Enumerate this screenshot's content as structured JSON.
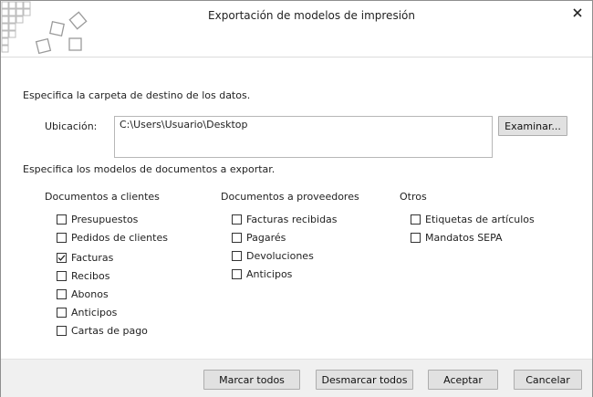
{
  "window": {
    "title": "Exportación de modelos de impresión"
  },
  "destination": {
    "instruction": "Especifica la carpeta de destino de los datos.",
    "location_label": "Ubicación:",
    "location_value": "C:\\Users\\Usuario\\Desktop",
    "browse_label": "Examinar..."
  },
  "models": {
    "instruction": "Especifica los modelos de documentos a exportar.",
    "groups": [
      {
        "title": "Documentos a clientes",
        "items": [
          {
            "label": "Presupuestos",
            "checked": false
          },
          {
            "label": "Pedidos de clientes",
            "checked": false
          },
          {
            "label": "Facturas",
            "checked": true
          },
          {
            "label": "Recibos",
            "checked": false
          },
          {
            "label": "Abonos",
            "checked": false
          },
          {
            "label": "Anticipos",
            "checked": false
          },
          {
            "label": "Cartas de pago",
            "checked": false
          }
        ]
      },
      {
        "title": "Documentos a proveedores",
        "items": [
          {
            "label": "Facturas recibidas",
            "checked": false
          },
          {
            "label": "Pagarés",
            "checked": false
          },
          {
            "label": "Devoluciones",
            "checked": false
          },
          {
            "label": "Anticipos",
            "checked": false
          }
        ]
      },
      {
        "title": "Otros",
        "items": [
          {
            "label": "Etiquetas de artículos",
            "checked": false
          },
          {
            "label": "Mandatos SEPA",
            "checked": false
          }
        ]
      }
    ]
  },
  "buttons": {
    "select_all": "Marcar todos",
    "deselect_all": "Desmarcar todos",
    "accept": "Aceptar",
    "cancel": "Cancelar"
  },
  "colors": {
    "logo_squares": "#bdbdbd",
    "footer_bg": "#f0f0f0",
    "button_bg": "#e1e1e1"
  }
}
